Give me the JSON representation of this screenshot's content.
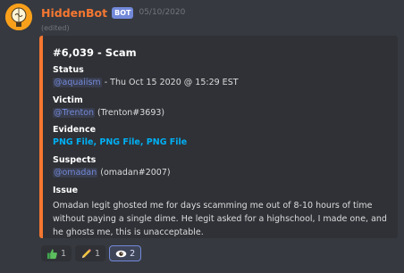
{
  "message": {
    "username": "HiddenBot",
    "bot_tag": "BOT",
    "timestamp": "05/10/2020",
    "edited": "(edited)"
  },
  "embed": {
    "accent_color": "#f57731",
    "title": "#6,039 - Scam",
    "status_label": "Status",
    "status_mention": "@aquaiism",
    "status_text": " - Thu Oct 15 2020 @ 15:29 EST",
    "victim_label": "Victim",
    "victim_mention": "@Trenton",
    "victim_tag": " (Trenton#3693)",
    "evidence_label": "Evidence",
    "evidence_links": [
      "PNG File",
      "PNG File",
      "PNG File"
    ],
    "evidence_sep": ", ",
    "suspects_label": "Suspects",
    "suspects_mention": "@omadan",
    "suspects_tag": " (omadan#2007)",
    "issue_label": "Issue",
    "issue_text": "Omadan legit ghosted me for days scamming me out of 8-10 hours of time without paying a single dime. He legit asked for a highschool, I made one, and he ghosts me, this is unacceptable."
  },
  "reactions": [
    {
      "icon": "thumbs-up-icon",
      "count": "1",
      "selected": false
    },
    {
      "icon": "pencil-icon",
      "count": "1",
      "selected": false
    },
    {
      "icon": "eye-icon",
      "count": "2",
      "selected": true
    }
  ]
}
